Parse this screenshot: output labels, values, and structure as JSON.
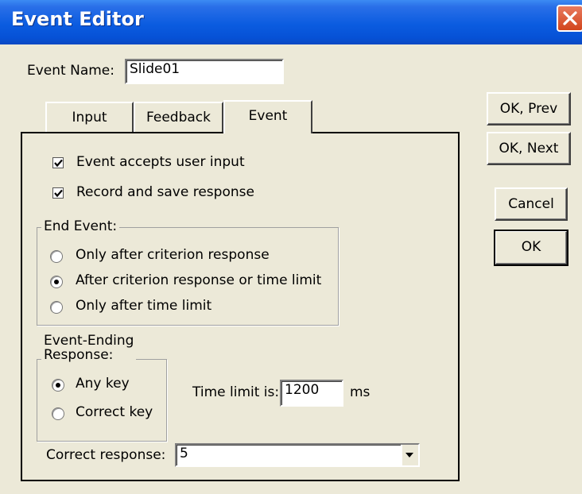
{
  "window": {
    "title": "Event Editor"
  },
  "event_name": {
    "label": "Event Name:",
    "value": "Slide01"
  },
  "tabs": [
    {
      "label": "Input",
      "active": false
    },
    {
      "label": "Feedback",
      "active": false
    },
    {
      "label": "Event",
      "active": true
    }
  ],
  "options": {
    "accepts_input": {
      "label": "Event accepts user input",
      "checked": true
    },
    "record_response": {
      "label": "Record and save response",
      "checked": true
    }
  },
  "end_event": {
    "legend": "End Event:",
    "choices": [
      {
        "label": "Only after criterion response",
        "selected": false
      },
      {
        "label": "After criterion response or time limit",
        "selected": true
      },
      {
        "label": "Only after time limit",
        "selected": false
      }
    ]
  },
  "ending_response": {
    "legend_line1": "Event-Ending",
    "legend_line2": "Response:",
    "choices": [
      {
        "label": "Any key",
        "selected": true
      },
      {
        "label": "Correct key",
        "selected": false
      }
    ]
  },
  "time_limit": {
    "label": "Time limit is:",
    "value": "1200",
    "unit": "ms"
  },
  "correct_response": {
    "label": "Correct response:",
    "value": "5"
  },
  "buttons": {
    "ok_prev": "OK, Prev",
    "ok_next": "OK, Next",
    "cancel": "Cancel",
    "ok": "OK"
  },
  "icons": {
    "close": "close-icon",
    "check": "checkmark-icon",
    "dropdown": "chevron-down-icon"
  }
}
